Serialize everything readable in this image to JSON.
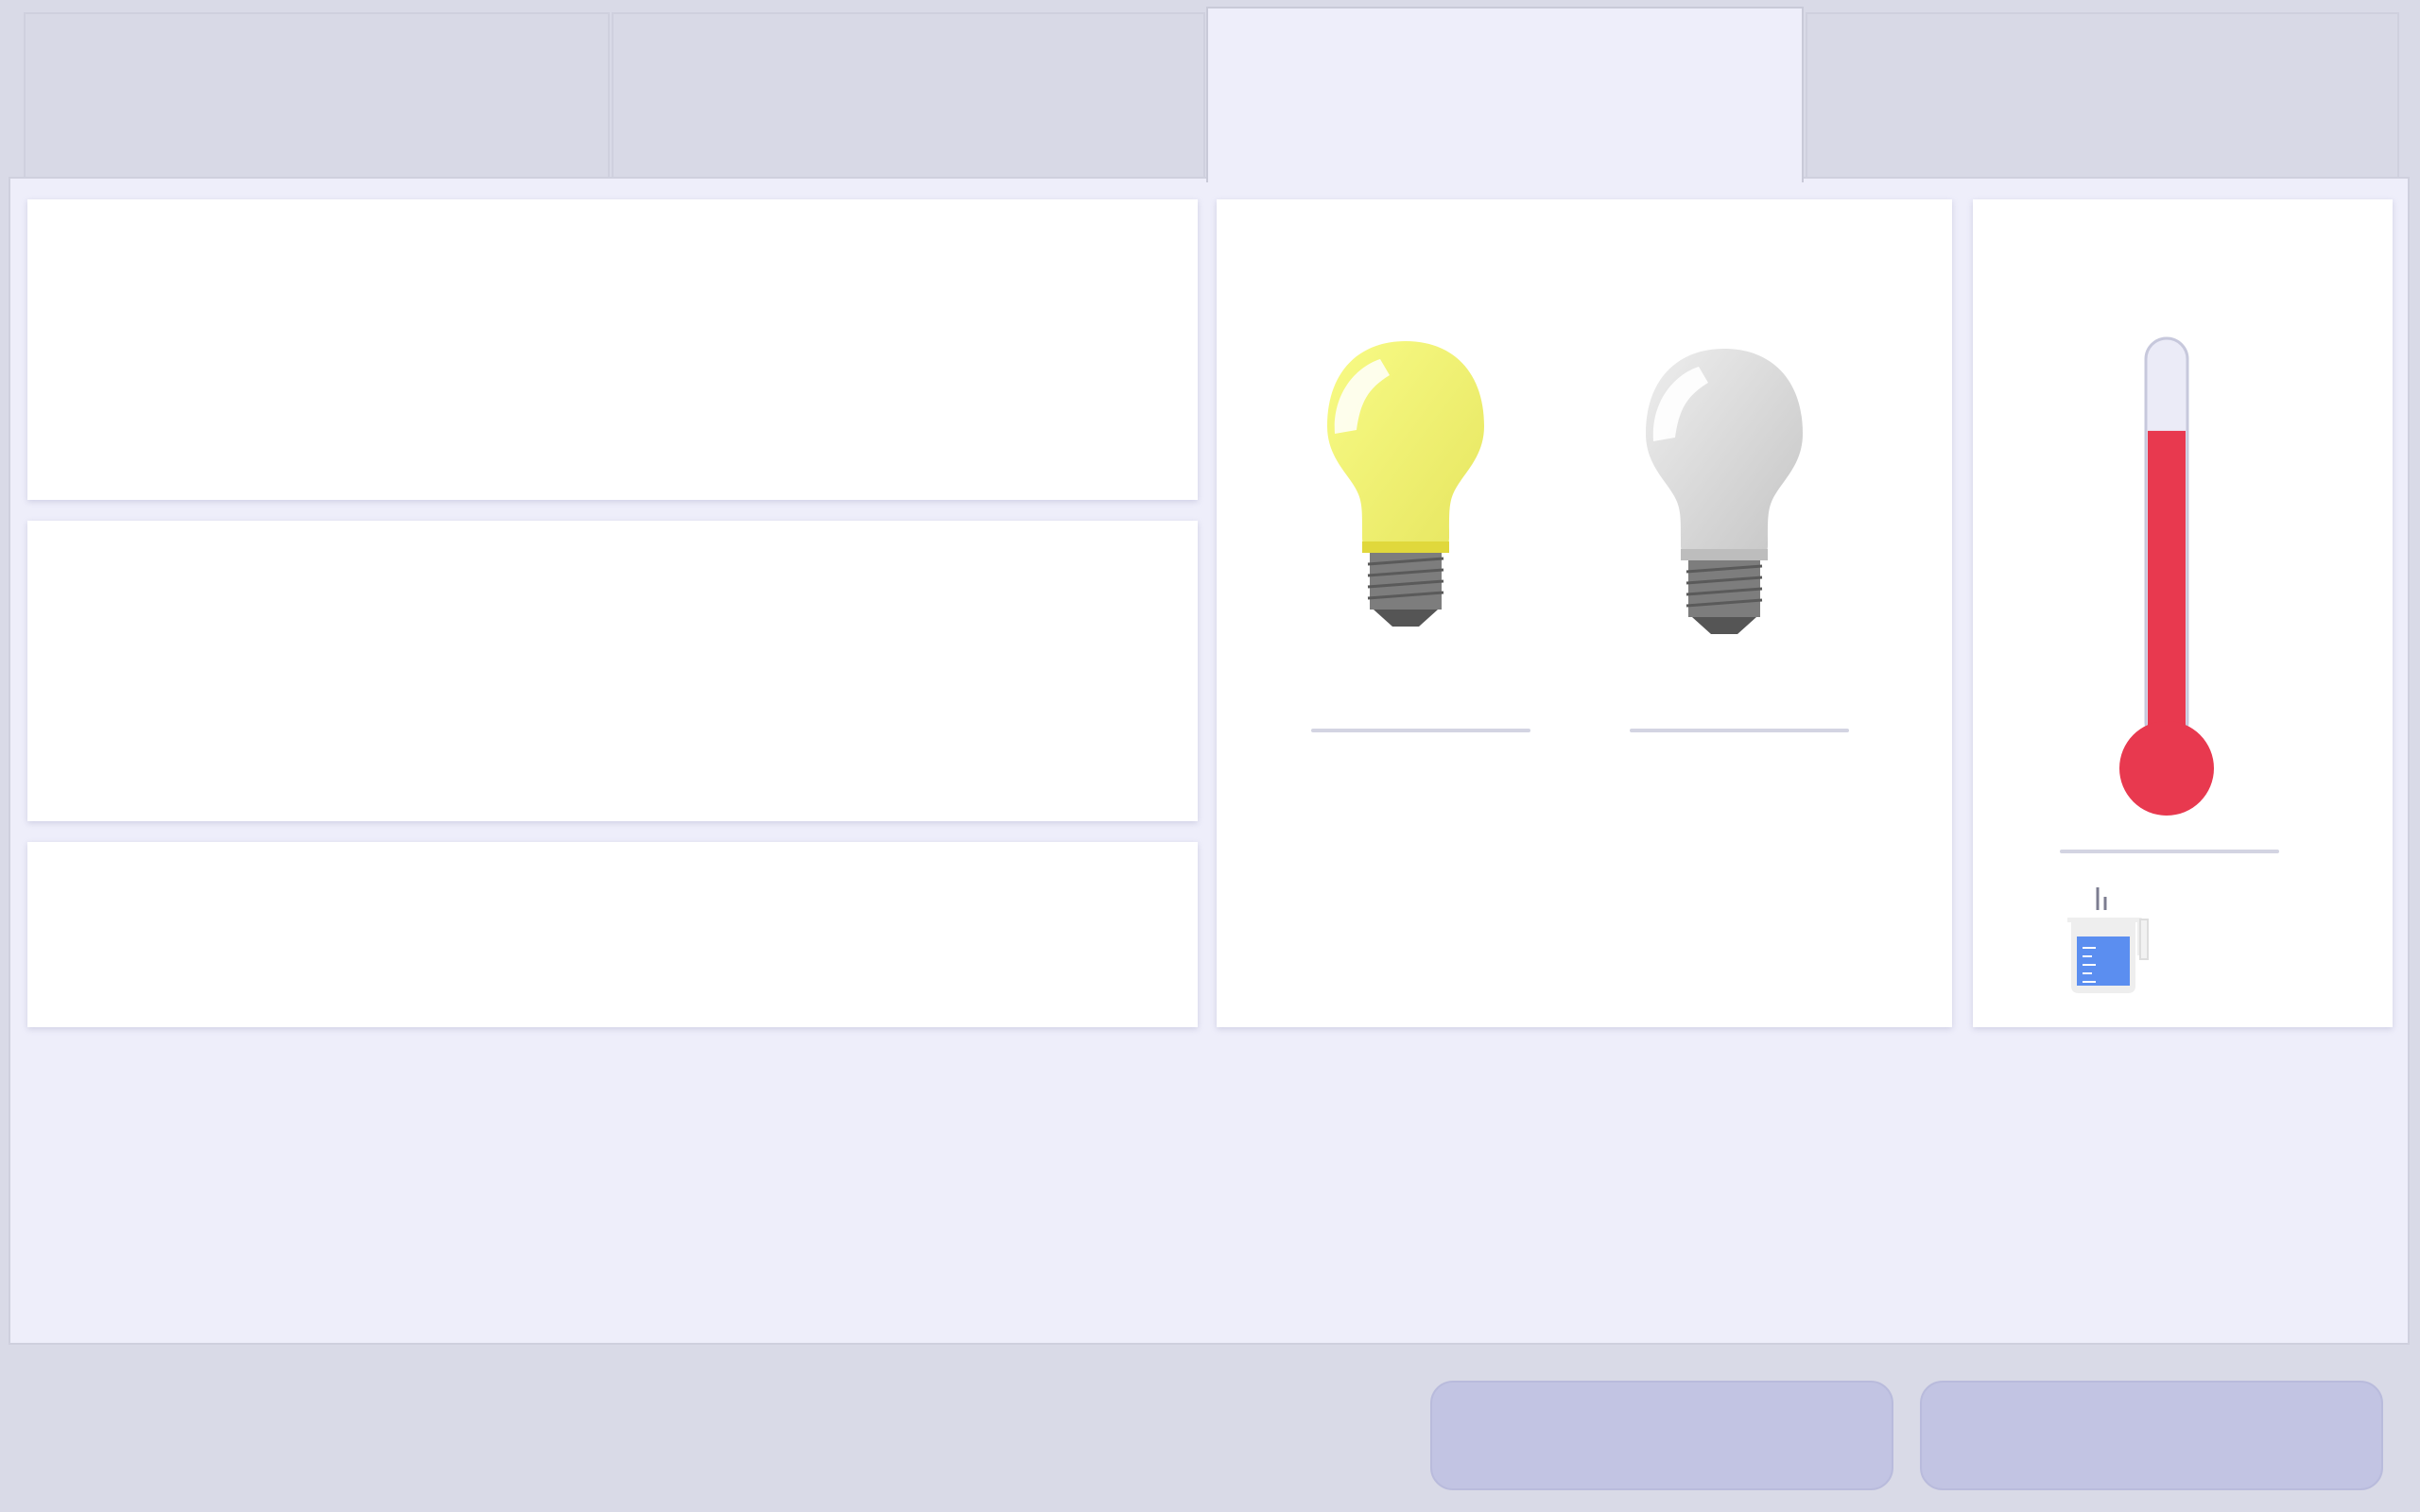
{
  "tabs": [
    {
      "label": "",
      "active": false
    },
    {
      "label": "",
      "active": false
    },
    {
      "label": "",
      "active": true
    },
    {
      "label": "",
      "active": false
    }
  ],
  "simulation_rows": [
    {
      "label": ""
    },
    {
      "label": ""
    },
    {
      "label": ""
    }
  ],
  "bulbs": [
    {
      "state": "on",
      "color": "#f3f36a",
      "label": ""
    },
    {
      "state": "off",
      "color": "#d9d9d9",
      "label": ""
    }
  ],
  "thermometer": {
    "fill_fraction": 0.78,
    "liquid_color": "#e8394f",
    "label": ""
  },
  "beaker": {
    "icon": "beaker-icon",
    "liquid_color": "#5b8ef0"
  },
  "actions": [
    {
      "label": ""
    },
    {
      "label": ""
    }
  ],
  "colors": {
    "background": "#d9dae7",
    "panel": "#eeeefa",
    "card": "#ffffff",
    "button": "#c2c4e3"
  }
}
